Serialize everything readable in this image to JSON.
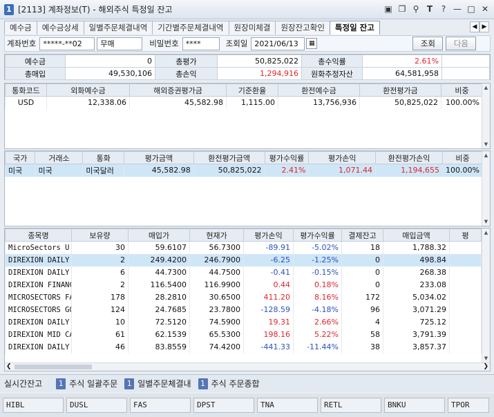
{
  "window": {
    "badge": "1",
    "title": "[2113] 계좌정보(T) - 해외주식 특정일 잔고",
    "icons": [
      "restore-icon",
      "copy-icon",
      "pin-icon",
      "font-icon",
      "help-icon",
      "minimize-icon",
      "maximize-icon",
      "close-icon"
    ]
  },
  "tabs": [
    "예수금",
    "예수금상세",
    "일별주문체결내역",
    "기간별주문체결내역",
    "원장미체결",
    "원장잔고확인",
    "특정일 잔고"
  ],
  "active_tab": 6,
  "controls": {
    "account_label": "계좌번호",
    "account_value": "*****-**02",
    "account_type": "무매",
    "password_label": "비밀번호",
    "password_value": "****",
    "date_label": "조회일",
    "date_value": "2021/06/13",
    "search_label": "조회",
    "next_label": "다음"
  },
  "summary": {
    "deposit_label": "예수금",
    "deposit": "0",
    "total_eval_label": "총평가",
    "total_eval": "50,825,022",
    "total_return_label": "총수익률",
    "total_return": "2.61%",
    "total_buy_label": "총매입",
    "total_buy": "49,530,106",
    "total_pl_label": "총손익",
    "total_pl": "1,294,916",
    "krw_asset_label": "원화추정자산",
    "krw_asset": "64,581,958"
  },
  "currency_table": {
    "headers": [
      "통화코드",
      "외화예수금",
      "해외증권평가금",
      "기준환율",
      "환전예수금",
      "환전평가금",
      "비중"
    ],
    "rows": [
      [
        "USD",
        "12,338.06",
        "45,582.98",
        "1,115.00",
        "13,756,936",
        "50,825,022",
        "100.00%"
      ]
    ]
  },
  "country_table": {
    "headers": [
      "국가",
      "거래소",
      "통화",
      "평가금액",
      "환전평가금액",
      "평가수익률",
      "평가손익",
      "환전평가손익",
      "비중"
    ],
    "rows": [
      [
        "미국",
        "미국",
        "미국달러",
        "45,582.98",
        "50,825,022",
        "2.41%",
        "1,071.44",
        "1,194,655",
        "100.00%"
      ]
    ]
  },
  "holdings_table": {
    "headers": [
      "종목명",
      "보유량",
      "매입가",
      "현재가",
      "평가손익",
      "평가수익률",
      "결제잔고",
      "매입금액",
      "평"
    ],
    "rows": [
      [
        "MicroSectors U.",
        "30",
        "59.6107",
        "56.7300",
        "-89.91",
        "-5.02%",
        "18",
        "1,788.32",
        "neg"
      ],
      [
        "DIREXION DAILY",
        "2",
        "249.4200",
        "246.7900",
        "-6.25",
        "-1.25%",
        "0",
        "498.84",
        "neg"
      ],
      [
        "DIREXION DAILY",
        "6",
        "44.7300",
        "44.7500",
        "-0.41",
        "-0.15%",
        "0",
        "268.38",
        "neg"
      ],
      [
        "DIREXION FINANC",
        "2",
        "116.5400",
        "116.9900",
        "0.44",
        "0.18%",
        "0",
        "233.08",
        "pos"
      ],
      [
        "MICROSECTORS FA",
        "178",
        "28.2810",
        "30.6500",
        "411.20",
        "8.16%",
        "172",
        "5,034.02",
        "pos"
      ],
      [
        "MICROSECTORS GO",
        "124",
        "24.7685",
        "23.7800",
        "-128.59",
        "-4.18%",
        "96",
        "3,071.29",
        "neg"
      ],
      [
        "DIREXION DAILY",
        "10",
        "72.5120",
        "74.5900",
        "19.31",
        "2.66%",
        "4",
        "725.12",
        "pos"
      ],
      [
        "DIREXION MID CA",
        "61",
        "62.1539",
        "65.5300",
        "198.16",
        "5.22%",
        "58",
        "3,791.39",
        "pos"
      ],
      [
        "DIREXION DAILY",
        "46",
        "83.8559",
        "74.4200",
        "-441.33",
        "-11.44%",
        "38",
        "3,857.37",
        "neg"
      ]
    ]
  },
  "bottom_bar": {
    "realtime_label": "실시간잔고",
    "items": [
      {
        "num": "1",
        "label": "주식 일괄주문"
      },
      {
        "num": "1",
        "label": "일별주문체결내"
      },
      {
        "num": "1",
        "label": "주식 주문종합"
      }
    ]
  },
  "tickers": [
    "HIBL",
    "DUSL",
    "FAS",
    "DPST",
    "TNA",
    "RETL",
    "BNKU",
    "TPOR"
  ],
  "colors": {
    "positive": "#e0242b",
    "negative": "#2a4fc3",
    "selected_row": "#cfe6f7"
  }
}
